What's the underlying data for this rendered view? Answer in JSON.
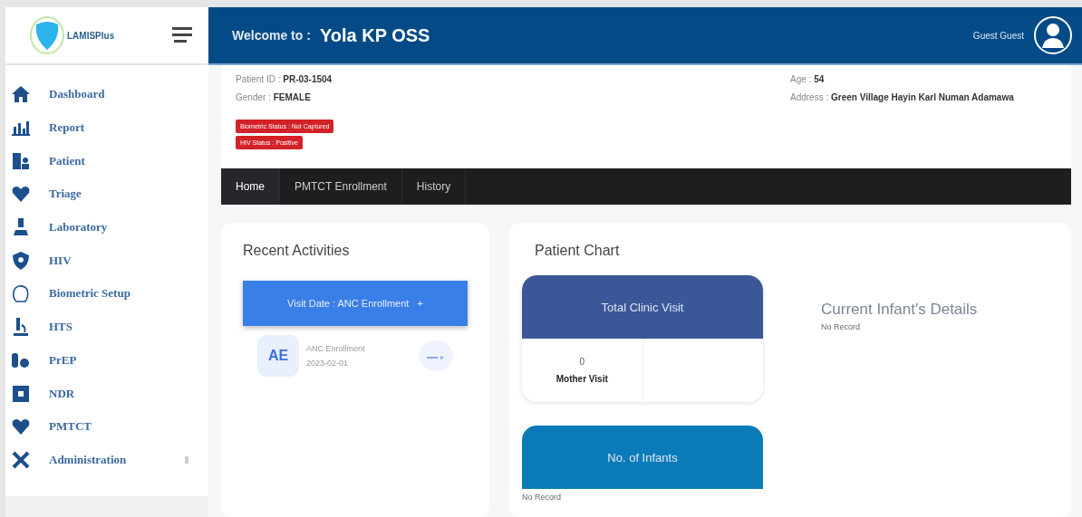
{
  "sidebar": {
    "logo": "LAMISPlus",
    "items": [
      {
        "label": "Dashboard",
        "kind": "home",
        "has_submenu": false
      },
      {
        "label": "Report",
        "kind": "chart",
        "has_submenu": false
      },
      {
        "label": "Patient",
        "kind": "patient",
        "has_submenu": false
      },
      {
        "label": "Triage",
        "kind": "heart",
        "has_submenu": false
      },
      {
        "label": "Laboratory",
        "kind": "flask",
        "has_submenu": false
      },
      {
        "label": "HIV",
        "kind": "shield",
        "has_submenu": false
      },
      {
        "label": "Biometric Setup",
        "kind": "hand",
        "has_submenu": false
      },
      {
        "label": "HTS",
        "kind": "test",
        "has_submenu": false
      },
      {
        "label": "PrEP",
        "kind": "pills",
        "has_submenu": false
      },
      {
        "label": "NDR",
        "kind": "square",
        "has_submenu": false
      },
      {
        "label": "PMTCT",
        "kind": "heart",
        "has_submenu": false
      },
      {
        "label": "Administration",
        "kind": "tools",
        "has_submenu": true
      }
    ]
  },
  "header": {
    "welcome": "Welcome to :",
    "facility": "Yola KP OSS",
    "user": "Guest Guest"
  },
  "patient": {
    "id_label": "Patient ID :",
    "id": "PR-03-1504",
    "gender_label": "Gender :",
    "gender": "FEMALE",
    "age_label": "Age :",
    "age": "54",
    "address_label": "Address :",
    "address": "Green Village Hayin Karl Numan Adamawa",
    "badges": [
      "Biometric Status : Not Captured",
      "HIV Status : Positive"
    ]
  },
  "tabs": [
    {
      "label": "Home",
      "selected": true
    },
    {
      "label": "PMTCT Enrollment",
      "selected": false
    },
    {
      "label": "History",
      "selected": false
    }
  ],
  "recent": {
    "title": "Recent Activities",
    "visit_button": "Visit Date : ANC Enrollment",
    "visit_plus": "+",
    "activities": [
      {
        "initials": "AE",
        "name": "ANC Enrollment",
        "date": "2023-02-01"
      }
    ]
  },
  "chart_panel": {
    "title": "Patient Chart",
    "clinic": {
      "title": "Total Clinic Visit",
      "value": "0",
      "label": "Mother Visit"
    },
    "infants": {
      "title": "No. of Infants",
      "empty": "No Record"
    },
    "infant_details": {
      "title": "Current Infant's Details",
      "empty": "No Record"
    }
  }
}
